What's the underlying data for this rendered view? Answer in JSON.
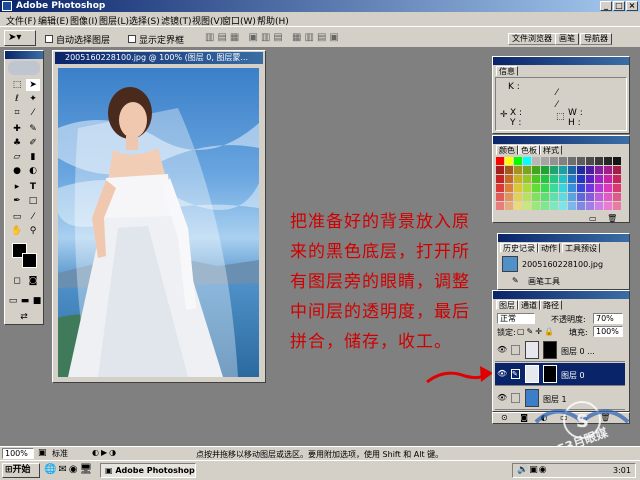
{
  "app": {
    "title": "Adobe Photoshop"
  },
  "window_buttons": {
    "minimize": "_",
    "maximize": "□",
    "close": "×"
  },
  "menu": [
    "文件(F)",
    "编辑(E)",
    "图像(I)",
    "图层(L)",
    "选择(S)",
    "滤镜(T)",
    "视图(V)",
    "窗口(W)",
    "帮助(H)"
  ],
  "options_bar": {
    "auto_select_label": "自动选择图层",
    "show_bounds_label": "显示定界框",
    "palette_tabs": [
      "文件浏览器",
      "画笔",
      "导航器"
    ]
  },
  "document": {
    "title": "2005160228100.jpg @ 100% (图层 0, 图层蒙..."
  },
  "instruction_lines": [
    "把准备好的背景放入原",
    "来的黑色底层，打开所",
    "有图层旁的眼睛，调整",
    "中间层的透明度，最后",
    "拼合，储存，收工。"
  ],
  "info_panel": {
    "tab": "信息",
    "k_label": "K :",
    "x_label": "X :",
    "y_label": "Y :",
    "w_label": "W :",
    "h_label": "H :"
  },
  "color_panel": {
    "tabs": [
      "颜色",
      "色板",
      "样式"
    ]
  },
  "history_panel": {
    "tabs": [
      "历史记录",
      "动作",
      "工具预设"
    ],
    "snapshot_name": "2005160228100.jpg",
    "step": "画笔工具",
    "step2": "画笔工具"
  },
  "layers_panel": {
    "tabs": [
      "图层",
      "通道",
      "路径"
    ],
    "blend_mode": "正常",
    "opacity_label": "不透明度:",
    "opacity_value": "70%",
    "lock_label": "锁定:",
    "fill_label": "填充:",
    "fill_value": "100%",
    "layers": [
      {
        "name": "图层 0 ..."
      },
      {
        "name": "图层 0"
      },
      {
        "name": "图层 1"
      }
    ]
  },
  "status_bar": {
    "zoom": "100%",
    "mode": "标准",
    "hint": "点按并拖移以移动图层或选区。要用附加选项，使用 Shift 和 Alt 键。"
  },
  "taskbar": {
    "start": "开始",
    "app": "Adobe Photoshop",
    "clock": "3:01"
  },
  "watermark": {
    "text": "53月眼媒"
  },
  "colors": {
    "title_dark": "#0a246a",
    "title_light": "#a6caf0",
    "instruction_red": "#d00000",
    "selected_layer": "#0a246a"
  }
}
